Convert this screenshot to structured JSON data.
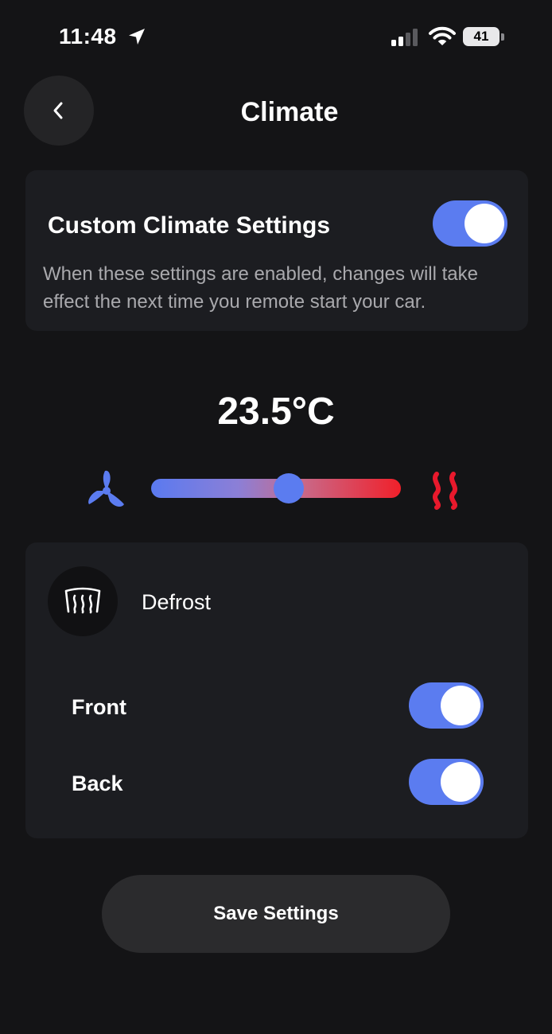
{
  "status_bar": {
    "time": "11:48",
    "battery_level": "41",
    "icons": [
      "location-arrow-icon",
      "cellular-signal-icon",
      "wifi-icon",
      "battery-icon"
    ]
  },
  "header": {
    "title": "Climate",
    "back_icon": "chevron-left-icon"
  },
  "custom_climate": {
    "title": "Custom Climate Settings",
    "description": "When these settings are enabled, changes will take effect the next time you remote start your car.",
    "enabled": true
  },
  "temperature": {
    "display": "23.5°C",
    "slider_level": 0.55,
    "cool_icon": "fan-icon",
    "heat_icon": "heat-waves-icon"
  },
  "defrost": {
    "label": "Defrost",
    "icon": "windshield-defrost-icon",
    "rows": [
      {
        "label": "Front",
        "enabled": true
      },
      {
        "label": "Back",
        "enabled": true
      }
    ]
  },
  "actions": {
    "save_label": "Save Settings"
  },
  "colors": {
    "background": "#141416",
    "card": "#1c1d21",
    "accent_blue": "#5b7cf0",
    "heat_red": "#f0202a"
  }
}
